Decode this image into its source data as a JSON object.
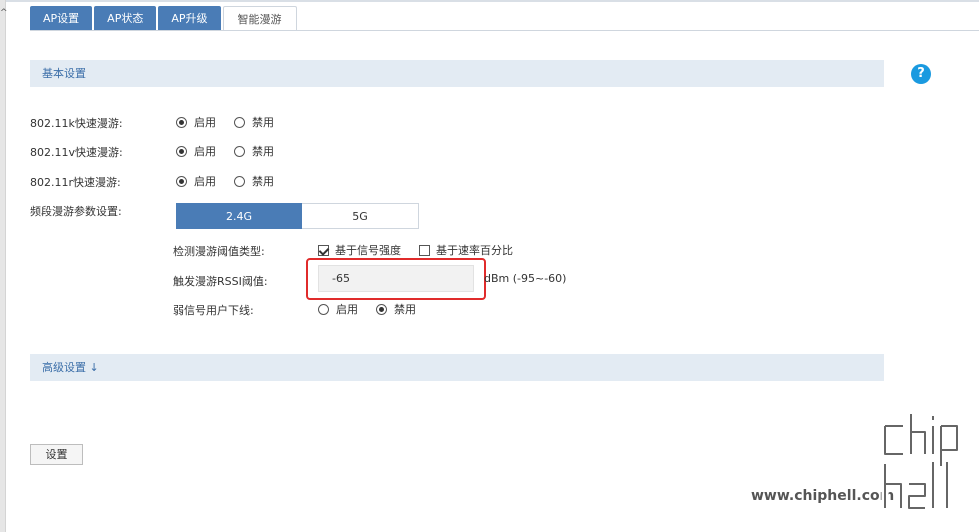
{
  "tabs": [
    {
      "label": "AP设置",
      "active": false
    },
    {
      "label": "AP状态",
      "active": false
    },
    {
      "label": "AP升级",
      "active": false
    },
    {
      "label": "智能漫游",
      "active": true
    }
  ],
  "basic_section": {
    "title": "基本设置",
    "help_label": "?"
  },
  "rows": {
    "k_label": "802.11k快速漫游:",
    "v_label": "802.11v快速漫游:",
    "r_label": "802.11r快速漫游:",
    "band_label": "频段漫游参数设置:",
    "enable": "启用",
    "disable": "禁用"
  },
  "radios": {
    "k": "enable",
    "v": "enable",
    "r": "enable",
    "weak_signal": "disable"
  },
  "bands": {
    "b24": "2.4G",
    "b5": "5G",
    "selected": "2.4G"
  },
  "threshold": {
    "type_label": "检测漫游阈值类型:",
    "signal_option": "基于信号强度",
    "signal_checked": true,
    "rate_option": "基于速率百分比",
    "rate_checked": false,
    "rssi_label": "触发漫游RSSI阈值:",
    "rssi_value": "-65",
    "rssi_unit": "dBm (-95~-60)",
    "weak_label": "弱信号用户下线:"
  },
  "advanced_section": {
    "title": "高级设置 ↓"
  },
  "set_button": "设置",
  "watermark": {
    "text": "www.chiphell.com",
    "logo": "chip hell"
  },
  "colors": {
    "tab_blue": "#4a7cb6",
    "section_bg": "#e3ebf3",
    "help_blue": "#1a9ae0",
    "highlight_red": "#e02b2b"
  }
}
